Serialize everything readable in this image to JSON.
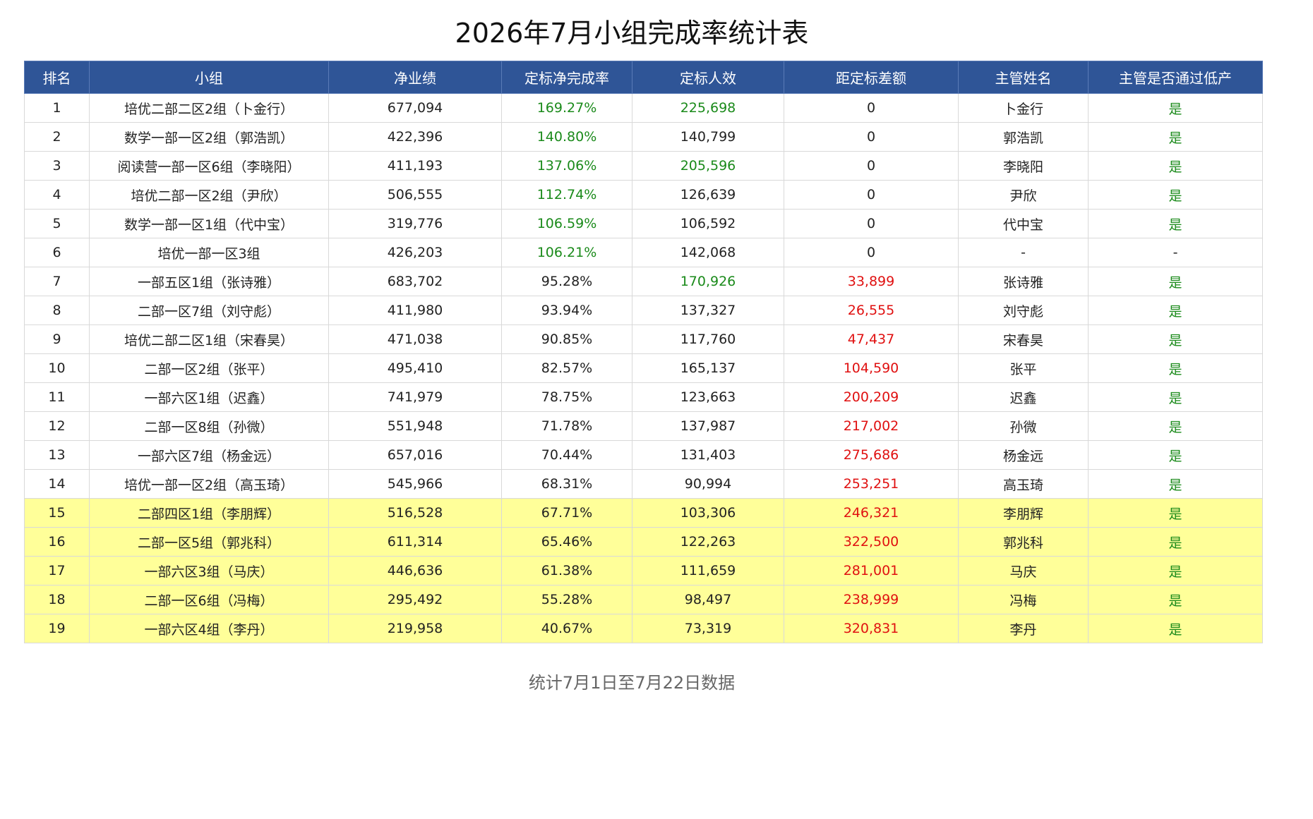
{
  "title": "2026年7月小组完成率统计表",
  "footer_note": "统计7月1日至7月22日数据",
  "colors": {
    "header_bg": "#2f5597",
    "header_text": "#ffffff",
    "good": "#1a8a1a",
    "bad": "#e01010",
    "highlight_row": "#ffff99"
  },
  "table": {
    "columns": [
      "排名",
      "小组",
      "净业绩",
      "定标净完成率",
      "定标人效",
      "距定标差额",
      "主管姓名",
      "主管是否通过低产"
    ],
    "rows": [
      {
        "rank": "1",
        "group": "培优二部二区2组（卜金行）",
        "net": "677,094",
        "rate": "169.27%",
        "eff": "225,698",
        "gap": "0",
        "manager": "卜金行",
        "passed": "是",
        "rate_good": true,
        "eff_good": true,
        "gap_bad": false,
        "highlight": false
      },
      {
        "rank": "2",
        "group": "数学一部一区2组（郭浩凯）",
        "net": "422,396",
        "rate": "140.80%",
        "eff": "140,799",
        "gap": "0",
        "manager": "郭浩凯",
        "passed": "是",
        "rate_good": true,
        "eff_good": false,
        "gap_bad": false,
        "highlight": false
      },
      {
        "rank": "3",
        "group": "阅读营一部一区6组（李晓阳）",
        "net": "411,193",
        "rate": "137.06%",
        "eff": "205,596",
        "gap": "0",
        "manager": "李晓阳",
        "passed": "是",
        "rate_good": true,
        "eff_good": true,
        "gap_bad": false,
        "highlight": false
      },
      {
        "rank": "4",
        "group": "培优二部一区2组（尹欣）",
        "net": "506,555",
        "rate": "112.74%",
        "eff": "126,639",
        "gap": "0",
        "manager": "尹欣",
        "passed": "是",
        "rate_good": true,
        "eff_good": false,
        "gap_bad": false,
        "highlight": false
      },
      {
        "rank": "5",
        "group": "数学一部一区1组（代中宝）",
        "net": "319,776",
        "rate": "106.59%",
        "eff": "106,592",
        "gap": "0",
        "manager": "代中宝",
        "passed": "是",
        "rate_good": true,
        "eff_good": false,
        "gap_bad": false,
        "highlight": false
      },
      {
        "rank": "6",
        "group": "培优一部一区3组",
        "net": "426,203",
        "rate": "106.21%",
        "eff": "142,068",
        "gap": "0",
        "manager": "-",
        "passed": "-",
        "rate_good": true,
        "eff_good": false,
        "gap_bad": false,
        "highlight": false
      },
      {
        "rank": "7",
        "group": "一部五区1组（张诗雅）",
        "net": "683,702",
        "rate": "95.28%",
        "eff": "170,926",
        "gap": "33,899",
        "manager": "张诗雅",
        "passed": "是",
        "rate_good": false,
        "eff_good": true,
        "gap_bad": true,
        "highlight": false
      },
      {
        "rank": "8",
        "group": "二部一区7组（刘守彪）",
        "net": "411,980",
        "rate": "93.94%",
        "eff": "137,327",
        "gap": "26,555",
        "manager": "刘守彪",
        "passed": "是",
        "rate_good": false,
        "eff_good": false,
        "gap_bad": true,
        "highlight": false
      },
      {
        "rank": "9",
        "group": "培优二部二区1组（宋春昊）",
        "net": "471,038",
        "rate": "90.85%",
        "eff": "117,760",
        "gap": "47,437",
        "manager": "宋春昊",
        "passed": "是",
        "rate_good": false,
        "eff_good": false,
        "gap_bad": true,
        "highlight": false
      },
      {
        "rank": "10",
        "group": "二部一区2组（张平）",
        "net": "495,410",
        "rate": "82.57%",
        "eff": "165,137",
        "gap": "104,590",
        "manager": "张平",
        "passed": "是",
        "rate_good": false,
        "eff_good": false,
        "gap_bad": true,
        "highlight": false
      },
      {
        "rank": "11",
        "group": "一部六区1组（迟鑫）",
        "net": "741,979",
        "rate": "78.75%",
        "eff": "123,663",
        "gap": "200,209",
        "manager": "迟鑫",
        "passed": "是",
        "rate_good": false,
        "eff_good": false,
        "gap_bad": true,
        "highlight": false
      },
      {
        "rank": "12",
        "group": "二部一区8组（孙微）",
        "net": "551,948",
        "rate": "71.78%",
        "eff": "137,987",
        "gap": "217,002",
        "manager": "孙微",
        "passed": "是",
        "rate_good": false,
        "eff_good": false,
        "gap_bad": true,
        "highlight": false
      },
      {
        "rank": "13",
        "group": "一部六区7组（杨金远）",
        "net": "657,016",
        "rate": "70.44%",
        "eff": "131,403",
        "gap": "275,686",
        "manager": "杨金远",
        "passed": "是",
        "rate_good": false,
        "eff_good": false,
        "gap_bad": true,
        "highlight": false
      },
      {
        "rank": "14",
        "group": "培优一部一区2组（高玉琦）",
        "net": "545,966",
        "rate": "68.31%",
        "eff": "90,994",
        "gap": "253,251",
        "manager": "高玉琦",
        "passed": "是",
        "rate_good": false,
        "eff_good": false,
        "gap_bad": true,
        "highlight": false
      },
      {
        "rank": "15",
        "group": "二部四区1组（李朋辉）",
        "net": "516,528",
        "rate": "67.71%",
        "eff": "103,306",
        "gap": "246,321",
        "manager": "李朋辉",
        "passed": "是",
        "rate_good": false,
        "eff_good": false,
        "gap_bad": true,
        "highlight": true
      },
      {
        "rank": "16",
        "group": "二部一区5组（郭兆科）",
        "net": "611,314",
        "rate": "65.46%",
        "eff": "122,263",
        "gap": "322,500",
        "manager": "郭兆科",
        "passed": "是",
        "rate_good": false,
        "eff_good": false,
        "gap_bad": true,
        "highlight": true
      },
      {
        "rank": "17",
        "group": "一部六区3组（马庆）",
        "net": "446,636",
        "rate": "61.38%",
        "eff": "111,659",
        "gap": "281,001",
        "manager": "马庆",
        "passed": "是",
        "rate_good": false,
        "eff_good": false,
        "gap_bad": true,
        "highlight": true
      },
      {
        "rank": "18",
        "group": "二部一区6组（冯梅）",
        "net": "295,492",
        "rate": "55.28%",
        "eff": "98,497",
        "gap": "238,999",
        "manager": "冯梅",
        "passed": "是",
        "rate_good": false,
        "eff_good": false,
        "gap_bad": true,
        "highlight": true
      },
      {
        "rank": "19",
        "group": "一部六区4组（李丹）",
        "net": "219,958",
        "rate": "40.67%",
        "eff": "73,319",
        "gap": "320,831",
        "manager": "李丹",
        "passed": "是",
        "rate_good": false,
        "eff_good": false,
        "gap_bad": true,
        "highlight": true
      }
    ]
  }
}
